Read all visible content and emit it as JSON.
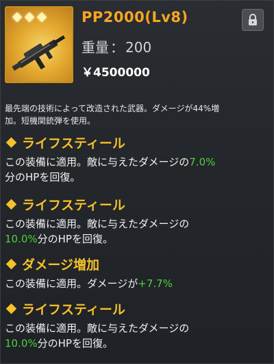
{
  "weapon": {
    "name": "PP2000(Lv8)",
    "weight_label": "重量",
    "weight_sep": "：",
    "weight_value": "200",
    "price_symbol": "￥",
    "price_value": "4500000",
    "rarity_stars": 3,
    "icon": "smg-weapon-icon"
  },
  "description": {
    "line1": "最先端の技術によって改造された武器。ダメージが44%増",
    "line2": "加。短機関銃弾を使用。"
  },
  "skills": [
    {
      "title": "ライフスティール",
      "desc_a": "この装備に適用。敵に与えたダメージの",
      "value": "7.0%",
      "desc_b": "分のHPを回復。"
    },
    {
      "title": "ライフスティール",
      "desc_a": "この装備に適用。敵に与えたダメージの",
      "value": "10.0%",
      "desc_b": "分のHPを回復。"
    },
    {
      "title": "ダメージ増加",
      "desc_a": "この装備に適用。ダメージが",
      "value": "+7.7%",
      "desc_b": ""
    },
    {
      "title": "ライフスティール",
      "desc_a": "この装備に適用。敵に与えたダメージの",
      "value": "10.0%",
      "desc_b": "分のHPを回復。"
    }
  ],
  "colors": {
    "title": "#f5a623",
    "skill_title": "#f5c02a",
    "value_green": "#4fd13b"
  }
}
